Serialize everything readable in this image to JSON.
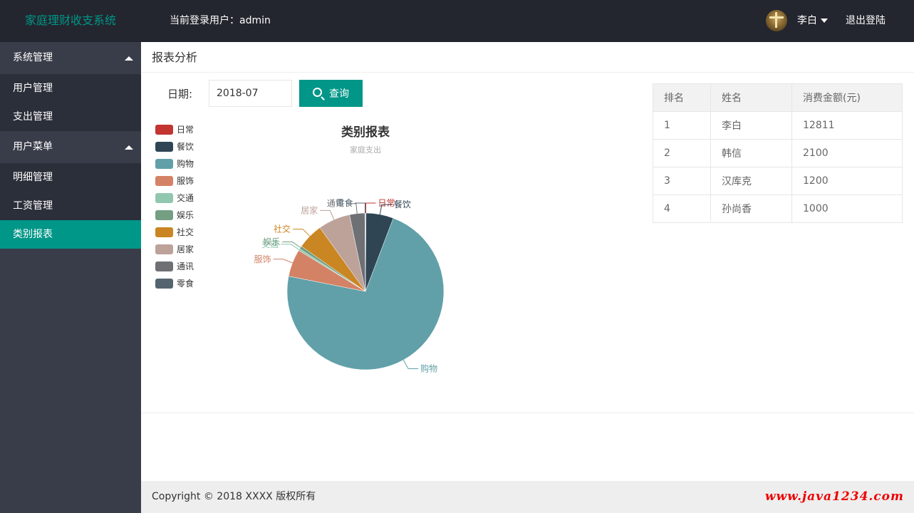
{
  "header": {
    "brand": "家庭理财收支系统",
    "login_user": "当前登录用户：admin",
    "user_name": "李白",
    "logout": "退出登陆"
  },
  "sidebar": {
    "groups": [
      {
        "label": "系统管理",
        "items": [
          {
            "label": "用户管理"
          },
          {
            "label": "支出管理"
          }
        ]
      },
      {
        "label": "用户菜单",
        "items": [
          {
            "label": "明细管理"
          },
          {
            "label": "工资管理"
          },
          {
            "label": "类别报表",
            "active": true
          }
        ]
      }
    ]
  },
  "main": {
    "page_title": "报表分析",
    "date_label": "日期:",
    "date_value": "2018-07",
    "query_label": "查询"
  },
  "chart_data": {
    "type": "pie",
    "title": "类别报表",
    "subtitle": "家庭支出",
    "legend_position": "left",
    "categories": [
      "日常",
      "餐饮",
      "购物",
      "服饰",
      "交通",
      "娱乐",
      "社交",
      "居家",
      "通讯",
      "零食"
    ],
    "values": [
      20,
      900,
      11500,
      900,
      60,
      100,
      850,
      1050,
      500,
      20
    ],
    "colors": [
      "#c23531",
      "#2f4554",
      "#61a0a8",
      "#d48265",
      "#91c7ae",
      "#749f83",
      "#ca8622",
      "#bda29a",
      "#6e7074",
      "#546570"
    ]
  },
  "ranking": {
    "headers": [
      "排名",
      "姓名",
      "消费金额(元)"
    ],
    "rows": [
      [
        "1",
        "李白",
        "12811"
      ],
      [
        "2",
        "韩信",
        "2100"
      ],
      [
        "3",
        "汉库克",
        "1200"
      ],
      [
        "4",
        "孙尚香",
        "1000"
      ]
    ]
  },
  "footer": {
    "copyright": "Copyright © 2018 XXXX 版权所有",
    "watermark": "www.java1234.com"
  }
}
